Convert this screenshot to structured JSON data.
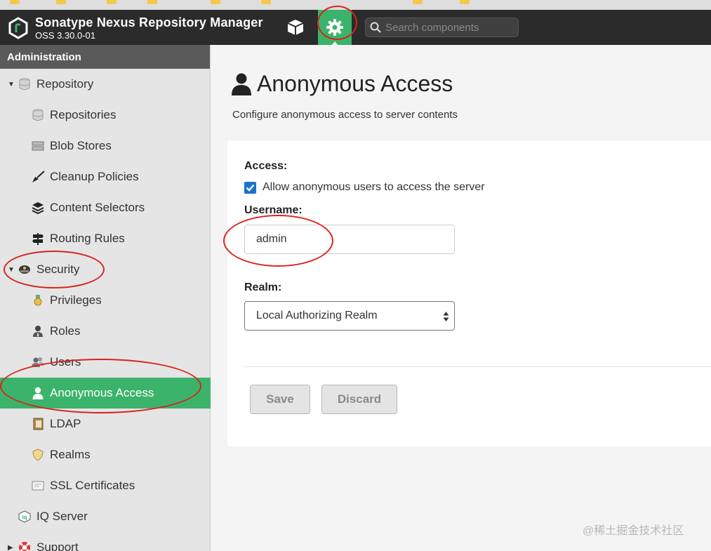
{
  "header": {
    "app_title": "Sonatype Nexus Repository Manager",
    "version": "OSS 3.30.0-01",
    "search_placeholder": "Search components"
  },
  "sidebar": {
    "heading": "Administration",
    "items": [
      {
        "label": "Repository",
        "icon": "database-icon",
        "level": 1,
        "expanded": true
      },
      {
        "label": "Repositories",
        "icon": "database-icon",
        "level": 2
      },
      {
        "label": "Blob Stores",
        "icon": "server-icon",
        "level": 2
      },
      {
        "label": "Cleanup Policies",
        "icon": "broom-icon",
        "level": 2
      },
      {
        "label": "Content Selectors",
        "icon": "layers-icon",
        "level": 2
      },
      {
        "label": "Routing Rules",
        "icon": "signpost-icon",
        "level": 2
      },
      {
        "label": "Security",
        "icon": "police-hat-icon",
        "level": 1,
        "expanded": true
      },
      {
        "label": "Privileges",
        "icon": "medal-icon",
        "level": 2
      },
      {
        "label": "Roles",
        "icon": "user-tie-icon",
        "level": 2
      },
      {
        "label": "Users",
        "icon": "users-icon",
        "level": 2
      },
      {
        "label": "Anonymous Access",
        "icon": "user-icon",
        "level": 2,
        "active": true
      },
      {
        "label": "LDAP",
        "icon": "address-book-icon",
        "level": 2
      },
      {
        "label": "Realms",
        "icon": "shield-icon",
        "level": 2
      },
      {
        "label": "SSL Certificates",
        "icon": "certificate-icon",
        "level": 2
      },
      {
        "label": "IQ Server",
        "icon": "iq-icon",
        "level": 1
      },
      {
        "label": "Support",
        "icon": "lifebuoy-icon",
        "level": 1,
        "expanded": false
      }
    ]
  },
  "main": {
    "title": "Anonymous Access",
    "description": "Configure anonymous access to server contents",
    "access_label": "Access:",
    "access_checkbox_label": "Allow anonymous users to access the server",
    "access_checked": true,
    "username_label": "Username:",
    "username_value": "admin",
    "realm_label": "Realm:",
    "realm_value": "Local Authorizing Realm",
    "save_label": "Save",
    "discard_label": "Discard"
  },
  "watermark": "@稀土掘金技术社区",
  "colors": {
    "accent": "#3bb36b",
    "header_bg": "#2b2b2b",
    "annotation": "#d9241c",
    "checkbox": "#1a73c9"
  }
}
